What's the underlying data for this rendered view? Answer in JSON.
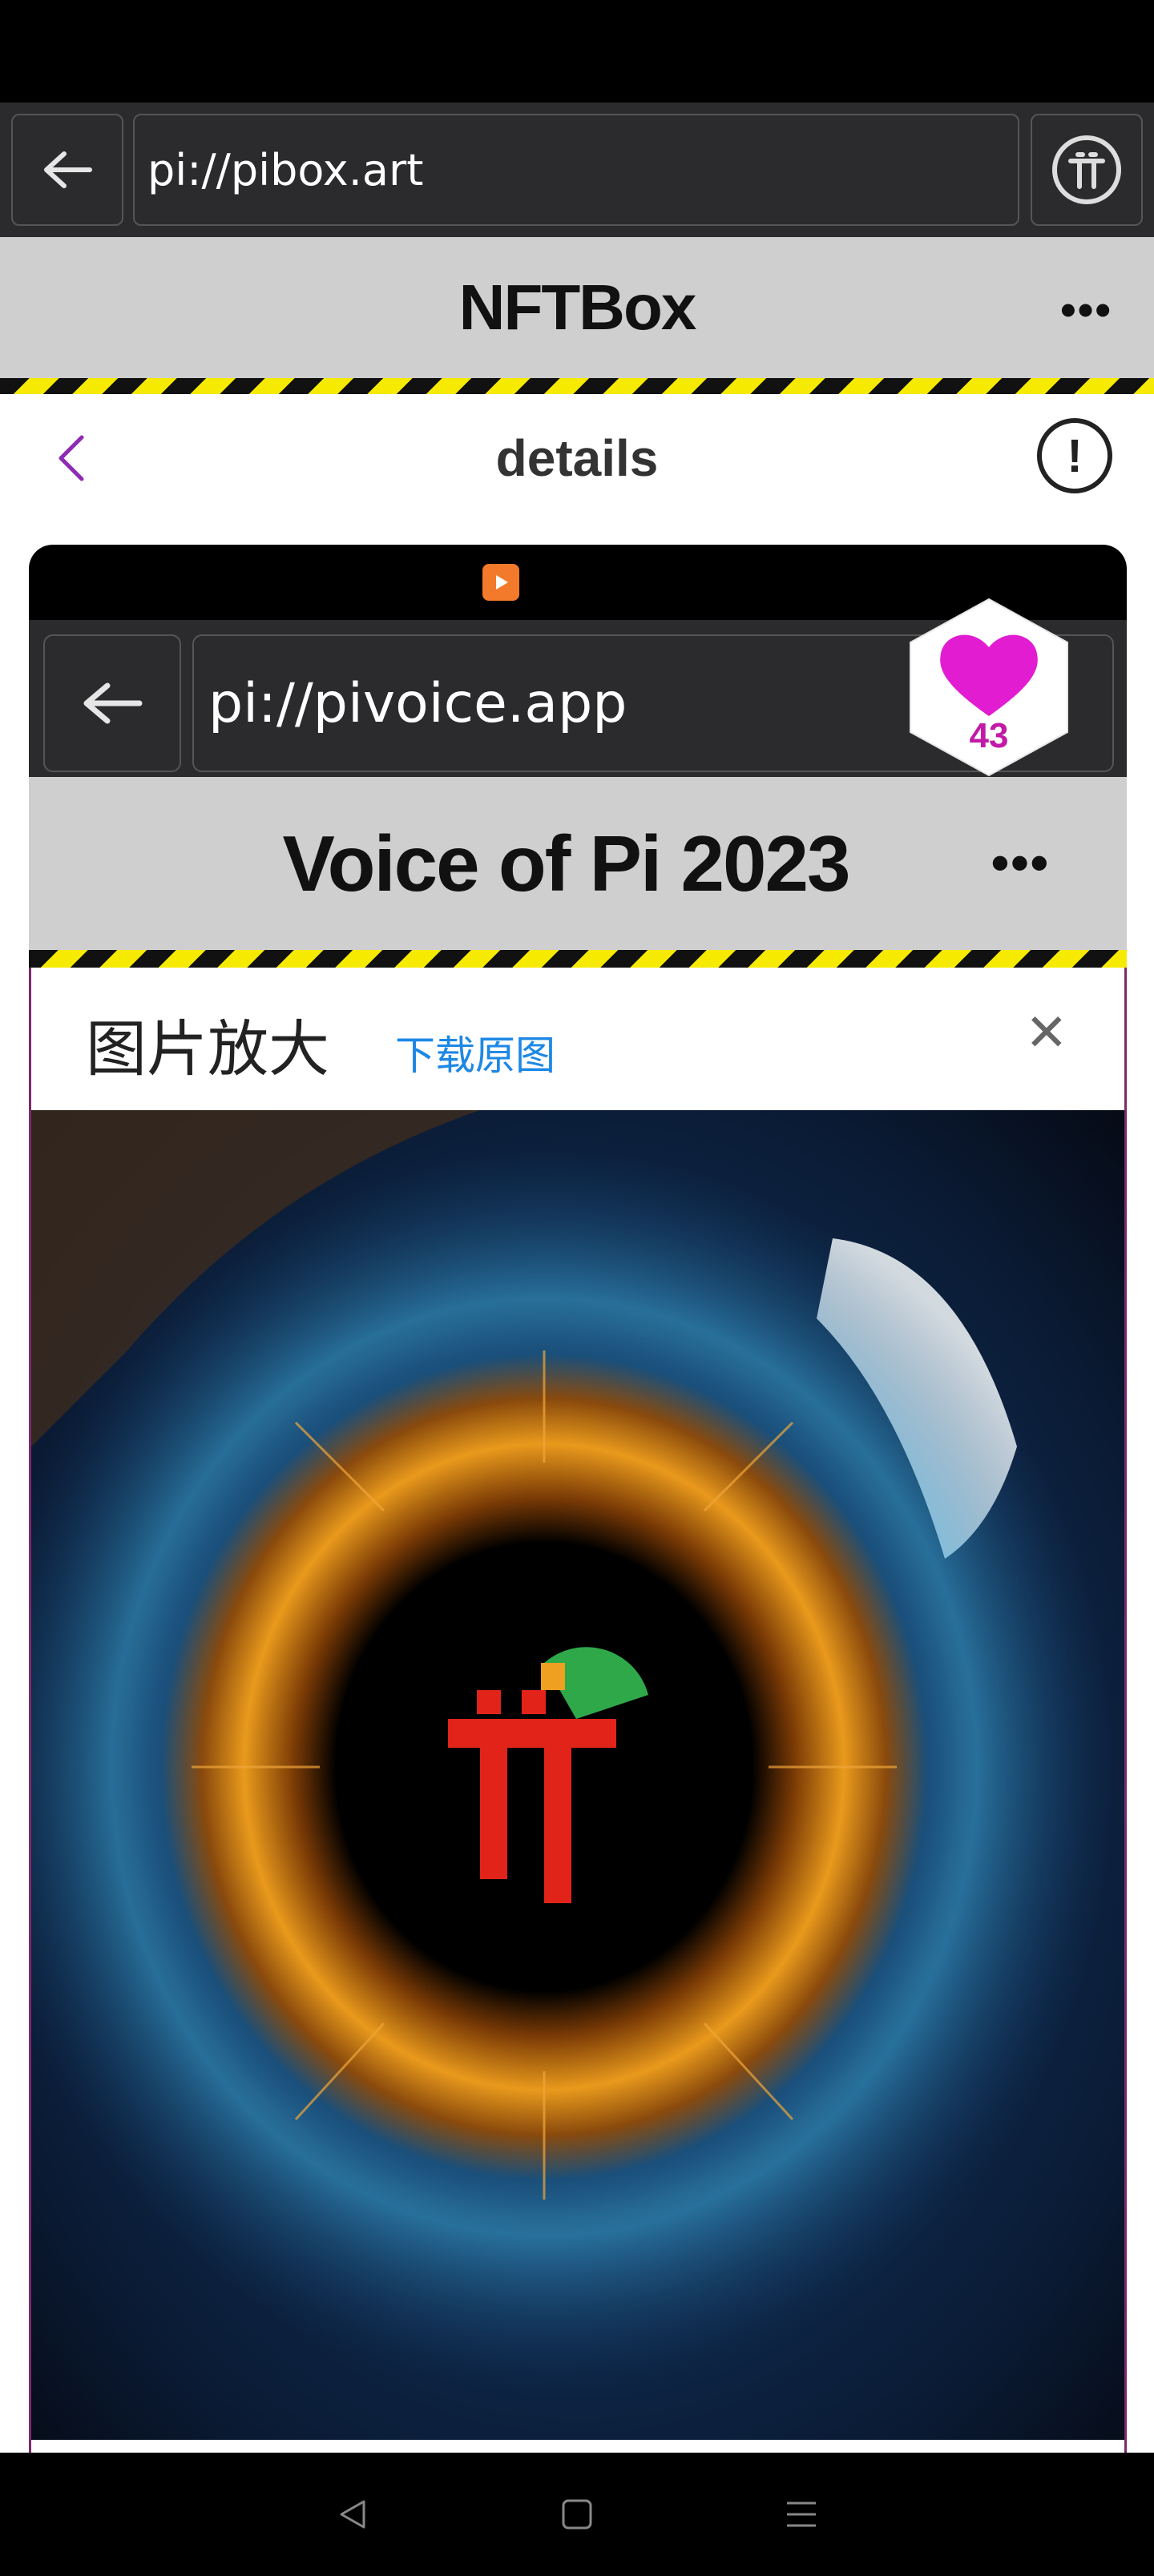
{
  "browser": {
    "url": "pi://pibox.art"
  },
  "app": {
    "title": "NFTBox",
    "more_label": "•••"
  },
  "details": {
    "title": "details",
    "info_label": "!"
  },
  "embedded": {
    "url": "pi://pivoice.app",
    "title": "Voice of Pi 2023",
    "more_label": "•••",
    "like_count": "43"
  },
  "zoom_panel": {
    "title": "图片放大",
    "download_label": "下载原图",
    "close_label": "✕"
  },
  "colors": {
    "accent_purple": "#8e2bb5",
    "link_blue": "#1d88e5",
    "hazard_yellow": "#f5ea00",
    "heart_magenta": "#e21cd0"
  },
  "icons": [
    "back-arrow-icon",
    "pi-logo-icon",
    "more-icon",
    "info-icon",
    "heart-icon",
    "close-icon",
    "nav-back-icon",
    "nav-home-icon",
    "nav-menu-icon"
  ]
}
